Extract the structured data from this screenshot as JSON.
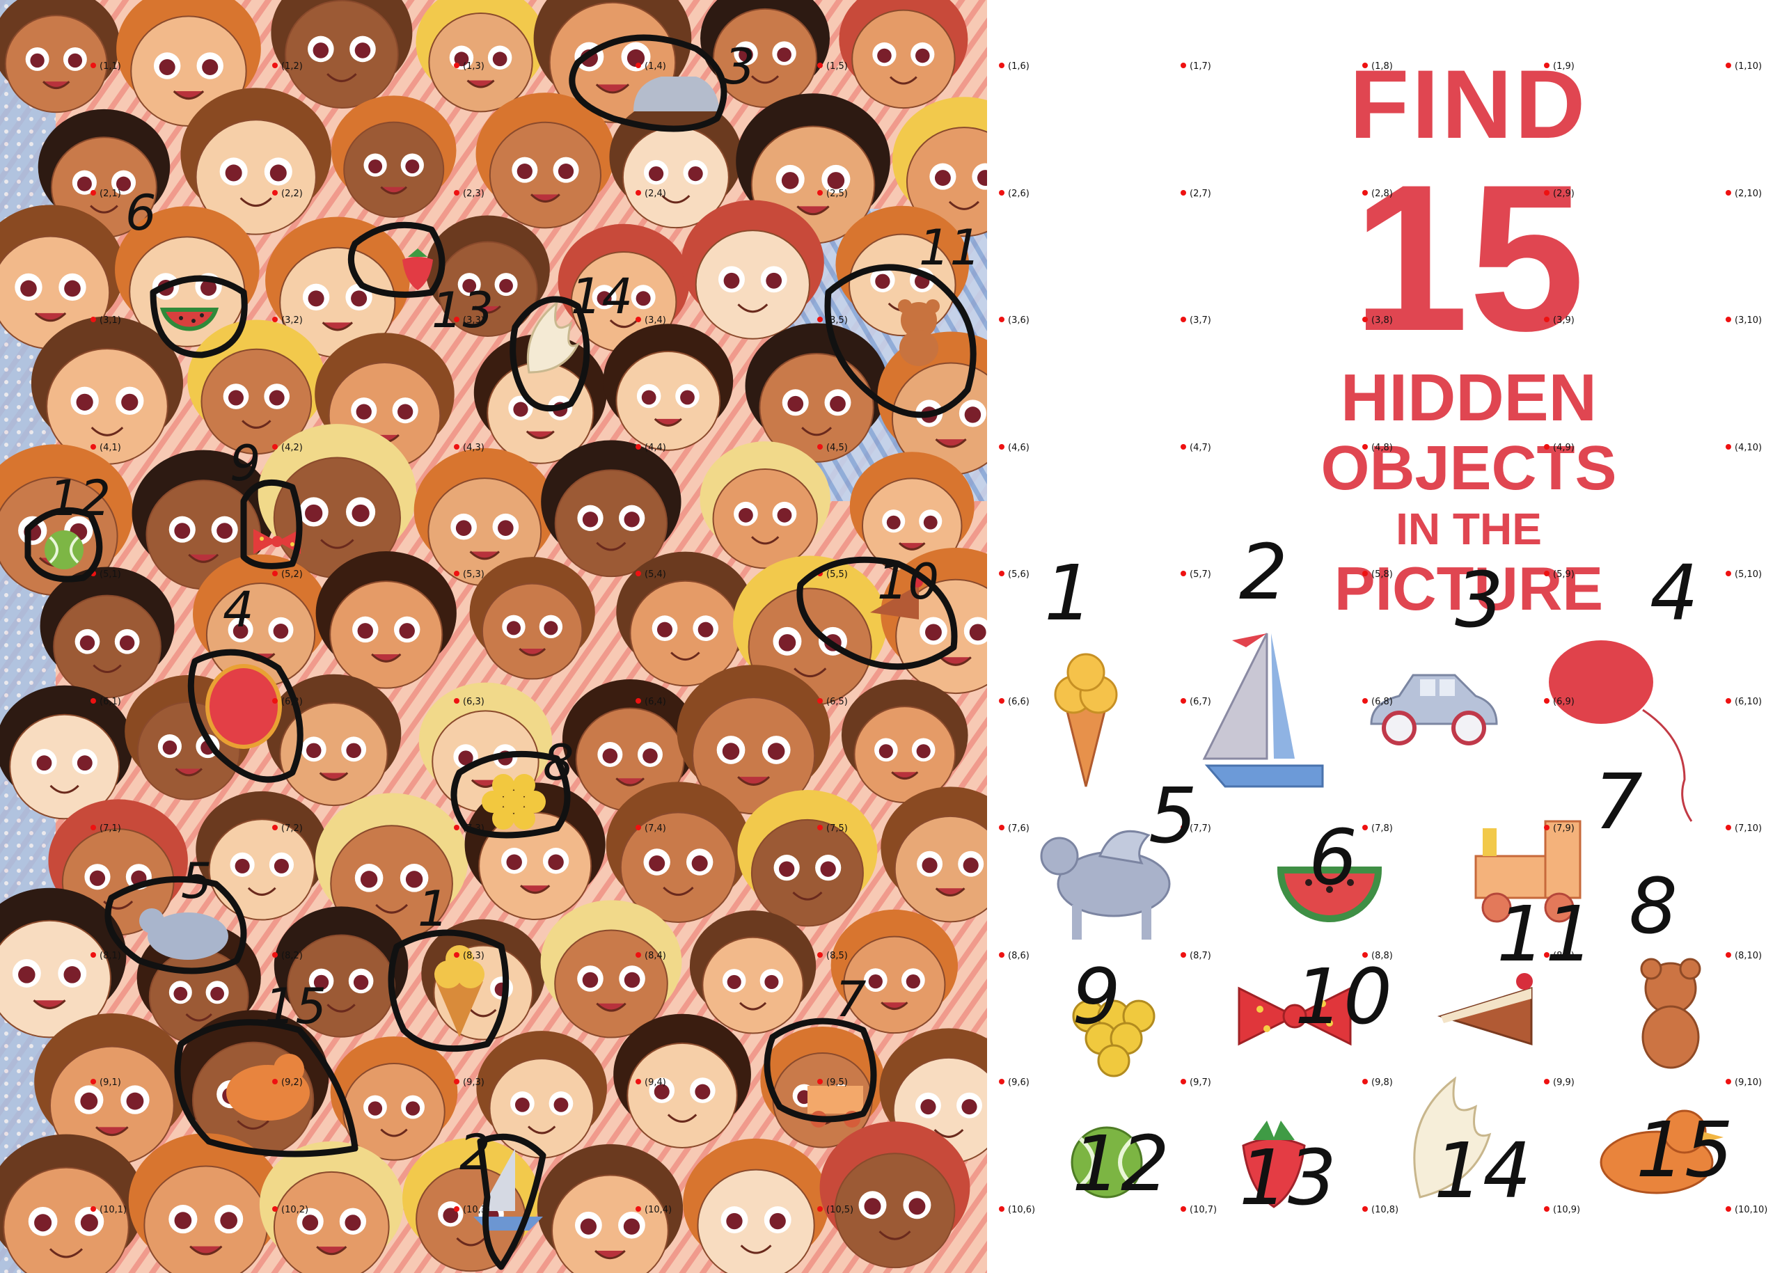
{
  "puzzle": {
    "title_line1": "FIND",
    "title_number": "15",
    "title_line2": "HIDDEN",
    "title_line3": "OBJECTS",
    "title_line4": "IN THE",
    "title_line5": "PICTURE"
  },
  "objects": [
    {
      "label": "1",
      "icon": "ice-cream-cone-icon"
    },
    {
      "label": "2",
      "icon": "sailboat-icon"
    },
    {
      "label": "3",
      "icon": "toy-car-icon"
    },
    {
      "label": "4",
      "icon": "red-balloon-icon"
    },
    {
      "label": "5",
      "icon": "flying-horse-icon"
    },
    {
      "label": "6",
      "icon": "watermelon-slice-icon"
    },
    {
      "label": "7",
      "icon": "toy-train-icon"
    },
    {
      "label": "8",
      "icon": "grapes-icon"
    },
    {
      "label": "9",
      "icon": "bow-tie-icon"
    },
    {
      "label": "10",
      "icon": "cake-slice-icon"
    },
    {
      "label": "11",
      "icon": "teddy-bear-icon"
    },
    {
      "label": "12",
      "icon": "tennis-ball-icon"
    },
    {
      "label": "13",
      "icon": "strawberry-icon"
    },
    {
      "label": "14",
      "icon": "wing-icon"
    },
    {
      "label": "15",
      "icon": "rubber-duck-icon"
    }
  ],
  "grid_labels": [
    "(1,1)",
    "(1,2)",
    "(1,3)",
    "(1,4)",
    "(1,5)",
    "(1,6)",
    "(1,7)",
    "(1,8)",
    "(1,9)",
    "(1,10)",
    "(2,1)",
    "(2,2)",
    "(2,3)",
    "(2,4)",
    "(2,5)",
    "(2,6)",
    "(2,7)",
    "(2,8)",
    "(2,9)",
    "(2,10)",
    "(3,1)",
    "(3,2)",
    "(3,3)",
    "(3,4)",
    "(3,5)",
    "(3,6)",
    "(3,7)",
    "(3,8)",
    "(3,9)",
    "(3,10)",
    "(4,1)",
    "(4,2)",
    "(4,3)",
    "(4,4)",
    "(4,5)",
    "(4,6)",
    "(4,7)",
    "(4,8)",
    "(4,9)",
    "(4,10)",
    "(5,1)",
    "(5,2)",
    "(5,3)",
    "(5,4)",
    "(5,5)",
    "(5,6)",
    "(5,7)",
    "(5,8)",
    "(5,9)",
    "(5,10)",
    "(6,1)",
    "(6,2)",
    "(6,3)",
    "(6,4)",
    "(6,5)",
    "(6,6)",
    "(6,7)",
    "(6,8)",
    "(6,9)",
    "(6,10)",
    "(7,1)",
    "(7,2)",
    "(7,3)",
    "(7,4)",
    "(7,5)",
    "(7,6)",
    "(7,7)",
    "(7,8)",
    "(7,9)",
    "(7,10)",
    "(8,1)",
    "(8,2)",
    "(8,3)",
    "(8,4)",
    "(8,5)",
    "(8,6)",
    "(8,7)",
    "(8,8)",
    "(8,9)",
    "(8,10)",
    "(9,1)",
    "(9,2)",
    "(9,3)",
    "(9,4)",
    "(9,5)",
    "(9,6)",
    "(9,7)",
    "(9,8)",
    "(9,9)",
    "(9,10)",
    "(10,1)",
    "(10,2)",
    "(10,3)",
    "(10,4)",
    "(10,5)",
    "(10,6)",
    "(10,7)",
    "(10,8)",
    "(10,9)",
    "(10,10)"
  ],
  "annotations": [
    {
      "label": "1",
      "target": "ice-cream"
    },
    {
      "label": "2",
      "target": "sailboat"
    },
    {
      "label": "3",
      "target": "car"
    },
    {
      "label": "4",
      "target": "balloon"
    },
    {
      "label": "5",
      "target": "horse"
    },
    {
      "label": "6",
      "target": "watermelon"
    },
    {
      "label": "7",
      "target": "train"
    },
    {
      "label": "8",
      "target": "grapes"
    },
    {
      "label": "9",
      "target": "bow"
    },
    {
      "label": "10",
      "target": "cake"
    },
    {
      "label": "11",
      "target": "bear"
    },
    {
      "label": "12",
      "target": "ball"
    },
    {
      "label": "13",
      "target": "strawberry"
    },
    {
      "label": "14",
      "target": "wing"
    },
    {
      "label": "15",
      "target": "duck"
    }
  ],
  "colors": {
    "accent": "#e04651",
    "ink": "#111111",
    "grid_dot": "#e11111"
  }
}
